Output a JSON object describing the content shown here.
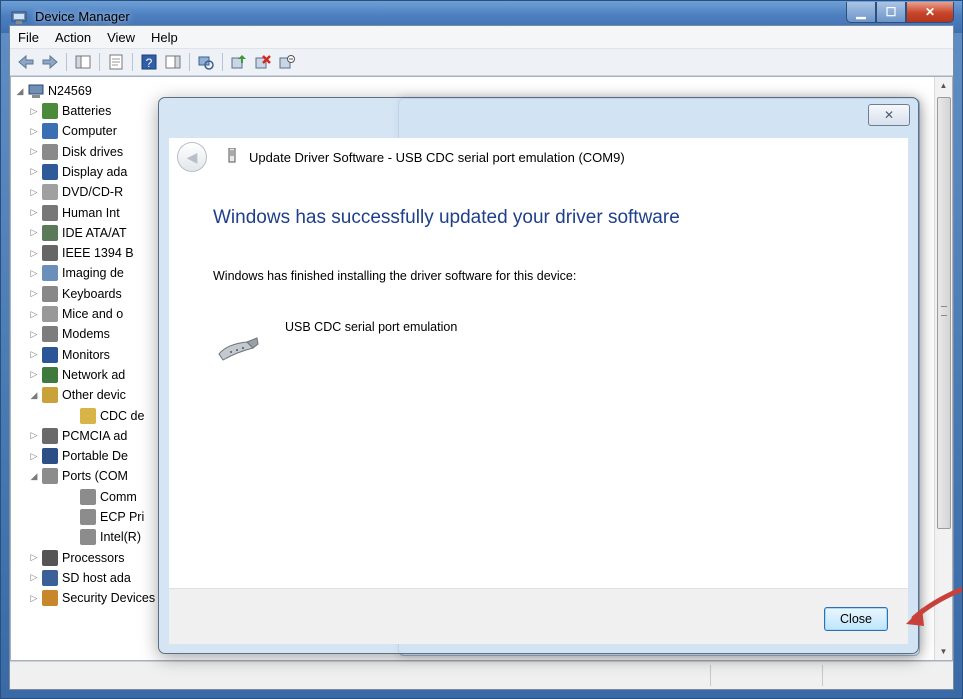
{
  "window": {
    "title": "Device Manager"
  },
  "menu": [
    "File",
    "Action",
    "View",
    "Help"
  ],
  "tree": {
    "root": "N24569",
    "items": [
      {
        "label": "Batteries",
        "expanded": false,
        "level": 1,
        "color": "#4a8a3a"
      },
      {
        "label": "Computer",
        "expanded": false,
        "level": 1,
        "color": "#3b6fb3"
      },
      {
        "label": "Disk drives",
        "expanded": false,
        "level": 1,
        "color": "#8a8a8a"
      },
      {
        "label": "Display ada",
        "expanded": false,
        "level": 1,
        "color": "#2e5a9a"
      },
      {
        "label": "DVD/CD-R",
        "expanded": false,
        "level": 1,
        "color": "#a0a0a0"
      },
      {
        "label": "Human Int",
        "expanded": false,
        "level": 1,
        "color": "#777777"
      },
      {
        "label": "IDE ATA/AT",
        "expanded": false,
        "level": 1,
        "color": "#5a7a5a"
      },
      {
        "label": "IEEE 1394 B",
        "expanded": false,
        "level": 1,
        "color": "#666666"
      },
      {
        "label": "Imaging de",
        "expanded": false,
        "level": 1,
        "color": "#6b8fb8"
      },
      {
        "label": "Keyboards",
        "expanded": false,
        "level": 1,
        "color": "#888888"
      },
      {
        "label": "Mice and o",
        "expanded": false,
        "level": 1,
        "color": "#999999"
      },
      {
        "label": "Modems",
        "expanded": false,
        "level": 1,
        "color": "#7d7d7d"
      },
      {
        "label": "Monitors",
        "expanded": false,
        "level": 1,
        "color": "#2b5597"
      },
      {
        "label": "Network ad",
        "expanded": false,
        "level": 1,
        "color": "#3e7a3e"
      },
      {
        "label": "Other devic",
        "expanded": true,
        "level": 1,
        "color": "#c9a23a"
      },
      {
        "label": "CDC de",
        "expanded": null,
        "level": 2,
        "color": "#d8b347"
      },
      {
        "label": "PCMCIA ad",
        "expanded": false,
        "level": 1,
        "color": "#6a6a6a"
      },
      {
        "label": "Portable De",
        "expanded": false,
        "level": 1,
        "color": "#2c4f86"
      },
      {
        "label": "Ports (COM",
        "expanded": true,
        "level": 1,
        "color": "#8c8c8c"
      },
      {
        "label": "Comm",
        "expanded": null,
        "level": 2,
        "color": "#8c8c8c"
      },
      {
        "label": "ECP Pri",
        "expanded": null,
        "level": 2,
        "color": "#8c8c8c"
      },
      {
        "label": "Intel(R)",
        "expanded": null,
        "level": 2,
        "color": "#8c8c8c"
      },
      {
        "label": "Processors",
        "expanded": false,
        "level": 1,
        "color": "#555555"
      },
      {
        "label": "SD host ada",
        "expanded": false,
        "level": 1,
        "color": "#3a5f99"
      },
      {
        "label": "Security Devices",
        "expanded": false,
        "level": 1,
        "color": "#c7872a"
      }
    ]
  },
  "dialog": {
    "header_title": "Update Driver Software - USB CDC serial port emulation (COM9)",
    "main_instruction": "Windows has successfully updated your driver software",
    "body_text": "Windows has finished installing the driver software for this device:",
    "device_name": "USB CDC serial port emulation",
    "close_label": "Close",
    "x_glyph": "✕"
  },
  "colors": {
    "instruction": "#1f3f8a",
    "arrow": "#c8403a"
  }
}
